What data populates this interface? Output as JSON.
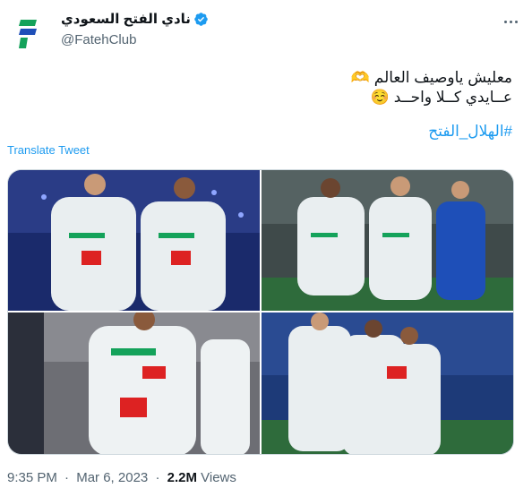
{
  "account": {
    "display_name": "نادي الفتح السعودي",
    "handle": "@FatehClub",
    "verified_icon": "verified-badge-icon",
    "avatar_icon": "fateh-club-logo-icon",
    "brand_colors": {
      "green": "#14a25a",
      "blue": "#1e4fb8"
    }
  },
  "tweet": {
    "lines": [
      "معليش ياوصيف العالم 🫶",
      "عــايدي كــلا واحــد ☺️"
    ],
    "hashtag": "#الهلال_الفتح",
    "translate_label": "Translate Tweet"
  },
  "media": {
    "photos": [
      {
        "name": "celebration-photo-1"
      },
      {
        "name": "celebration-photo-2"
      },
      {
        "name": "celebration-photo-3"
      },
      {
        "name": "celebration-photo-4"
      }
    ]
  },
  "meta": {
    "time": "9:35 PM",
    "separator": "·",
    "date": "Mar 6, 2023",
    "views_count": "2.2M",
    "views_label": "Views"
  },
  "colors": {
    "link": "#1d9bf0",
    "text": "#0f1419",
    "muted": "#536471",
    "border": "#cfd9de"
  }
}
